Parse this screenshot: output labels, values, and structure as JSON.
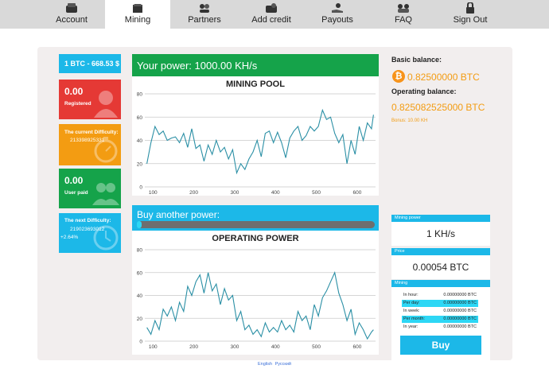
{
  "nav": {
    "items": [
      {
        "label": "Account",
        "icon": "wallet-icon"
      },
      {
        "label": "Mining",
        "icon": "pickaxe-icon"
      },
      {
        "label": "Partners",
        "icon": "partners-icon"
      },
      {
        "label": "Add credit",
        "icon": "add-credit-icon"
      },
      {
        "label": "Payouts",
        "icon": "payout-hand-icon"
      },
      {
        "label": "FAQ",
        "icon": "faq-icon"
      },
      {
        "label": "Sign Out",
        "icon": "lock-icon"
      }
    ],
    "active": "Mining"
  },
  "tiles": {
    "rate": "1 BTC - 668.53 $",
    "registered_value": "0.00",
    "registered_label": "Registered",
    "current_difficulty_label": "The current Difficulty:",
    "current_difficulty_value": "213398925331",
    "user_paid_value": "0.00",
    "user_paid_label": "User paid",
    "next_difficulty_label": "The next Difficulty:",
    "next_difficulty_value": "219023693012",
    "next_difficulty_change": "+2.64%"
  },
  "power": {
    "title": "Your power: 1000.00 KH/s",
    "buy_title": "Buy another power:",
    "progress": 0.02
  },
  "colors": {
    "green": "#15a34a",
    "blue": "#1cb8e8",
    "orange": "#f39c12",
    "red": "#e53935",
    "line": "#2a8fa5"
  },
  "chart_data": [
    {
      "type": "line",
      "title": "MINING POOL",
      "xlim": [
        80,
        645
      ],
      "ylim": [
        0,
        80
      ],
      "xticks": [
        100,
        200,
        300,
        400,
        500,
        600
      ],
      "yticks": [
        0,
        20,
        40,
        60,
        80
      ],
      "grid": true,
      "x": [
        85,
        95,
        105,
        115,
        125,
        135,
        145,
        155,
        165,
        175,
        185,
        195,
        205,
        215,
        225,
        235,
        245,
        255,
        265,
        275,
        285,
        295,
        305,
        315,
        325,
        335,
        345,
        355,
        365,
        375,
        385,
        395,
        405,
        415,
        425,
        435,
        445,
        455,
        465,
        475,
        485,
        495,
        505,
        515,
        525,
        535,
        545,
        555,
        565,
        575,
        585,
        595,
        605,
        615,
        625,
        635,
        640
      ],
      "y": [
        20,
        38,
        52,
        45,
        48,
        40,
        42,
        43,
        38,
        46,
        34,
        50,
        33,
        36,
        22,
        36,
        28,
        40,
        30,
        34,
        24,
        32,
        12,
        20,
        15,
        24,
        30,
        40,
        26,
        46,
        48,
        38,
        47,
        38,
        25,
        42,
        48,
        52,
        40,
        44,
        52,
        48,
        52,
        66,
        58,
        60,
        46,
        38,
        45,
        20,
        40,
        28,
        52,
        40,
        55,
        50,
        62
      ]
    },
    {
      "type": "line",
      "title": "OPERATING POWER",
      "xlim": [
        80,
        645
      ],
      "ylim": [
        0,
        80
      ],
      "xticks": [
        100,
        200,
        300,
        400,
        500,
        600
      ],
      "yticks": [
        0,
        20,
        40,
        60,
        80
      ],
      "grid": true,
      "x": [
        85,
        95,
        105,
        115,
        125,
        135,
        145,
        155,
        165,
        175,
        185,
        195,
        205,
        215,
        225,
        235,
        245,
        255,
        265,
        275,
        285,
        295,
        305,
        315,
        325,
        335,
        345,
        355,
        365,
        375,
        385,
        395,
        405,
        415,
        425,
        435,
        445,
        455,
        465,
        475,
        485,
        495,
        505,
        515,
        525,
        535,
        545,
        555,
        565,
        575,
        585,
        595,
        605,
        615,
        625,
        635,
        640
      ],
      "y": [
        12,
        6,
        18,
        10,
        28,
        22,
        30,
        18,
        34,
        26,
        48,
        40,
        52,
        58,
        42,
        60,
        44,
        50,
        32,
        46,
        36,
        40,
        18,
        26,
        10,
        14,
        6,
        10,
        4,
        16,
        8,
        12,
        8,
        18,
        10,
        14,
        8,
        26,
        18,
        22,
        10,
        32,
        22,
        38,
        44,
        52,
        60,
        42,
        32,
        18,
        28,
        6,
        16,
        10,
        2,
        8,
        10
      ]
    }
  ],
  "balance": {
    "basic_label": "Basic balance:",
    "basic_value": "0.82500000 BTC",
    "operating_label": "Operating balance:",
    "operating_value": "0.825082525000 BTC",
    "bonus": "Bonus: 10.00 KH"
  },
  "boxes": {
    "mining_power_label": "Mining power",
    "mining_power_value": "1 KH/s",
    "price_label": "Price",
    "price_value": "0.00054 BTC",
    "mining_label": "Mining",
    "rates": [
      {
        "period": "In hour:",
        "value": "0.00000000 BTC"
      },
      {
        "period": "Per day:",
        "value": "0.00000000 BTC"
      },
      {
        "period": "In week:",
        "value": "0.00000000 BTC"
      },
      {
        "period": "Per month:",
        "value": "0.00000000 BTC"
      },
      {
        "period": "In year:",
        "value": "0.00000000 BTC"
      }
    ],
    "buy_label": "Buy"
  },
  "footer": {
    "english": "English",
    "russian": "Русский"
  }
}
